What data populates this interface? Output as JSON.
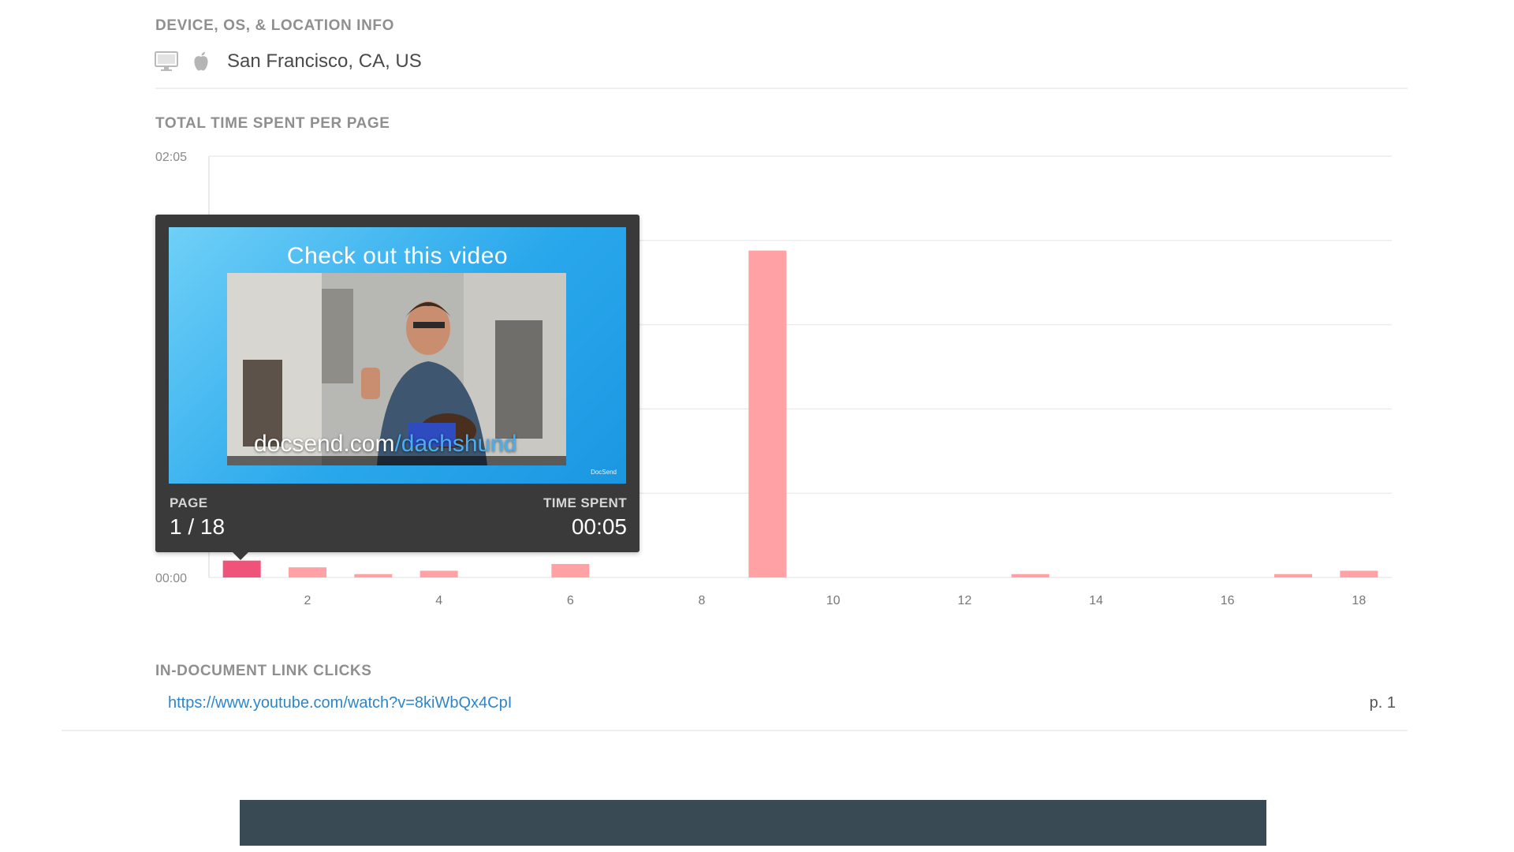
{
  "device_section": {
    "title": "DEVICE, OS, & LOCATION INFO",
    "device_icon": "desktop-monitor-icon",
    "os_icon": "apple-icon",
    "location": "San Francisco, CA, US"
  },
  "time_section": {
    "title": "TOTAL TIME SPENT PER PAGE"
  },
  "chart_data": {
    "type": "bar",
    "title": "TOTAL TIME SPENT PER PAGE",
    "xlabel": "",
    "ylabel": "",
    "categories": [
      1,
      2,
      3,
      4,
      5,
      6,
      7,
      8,
      9,
      10,
      11,
      12,
      13,
      14,
      15,
      16,
      17,
      18
    ],
    "values": [
      5,
      3,
      1,
      2,
      0,
      4,
      0,
      0,
      97,
      0,
      0,
      0,
      1,
      0,
      0,
      0,
      1,
      2
    ],
    "unit": "seconds",
    "ylim": [
      0,
      125
    ],
    "y_ticks": [
      "00:00",
      "02:05"
    ],
    "x_ticks": [
      "2",
      "4",
      "6",
      "8",
      "10",
      "12",
      "14",
      "16",
      "18"
    ],
    "highlighted_category": 1,
    "grid": true,
    "colors": {
      "bar": "#ffa1a5",
      "highlight": "#f0537a",
      "grid": "#ececec"
    }
  },
  "tooltip": {
    "slide_title": "Check out this video",
    "video_caption_prefix": "docsend.com",
    "video_caption_suffix": "/dachshund",
    "brand": "DocSend",
    "page_label": "PAGE",
    "page_value": "1 / 18",
    "time_label": "TIME SPENT",
    "time_value": "00:05"
  },
  "links_section": {
    "title": "IN-DOCUMENT LINK CLICKS",
    "links": [
      {
        "url": "https://www.youtube.com/watch?v=8kiWbQx4CpI",
        "page": "p. 1"
      }
    ]
  },
  "colors": {
    "link": "#2f86c7",
    "footer": "#3a4a54",
    "tooltip_bg": "#3a3a3a"
  }
}
